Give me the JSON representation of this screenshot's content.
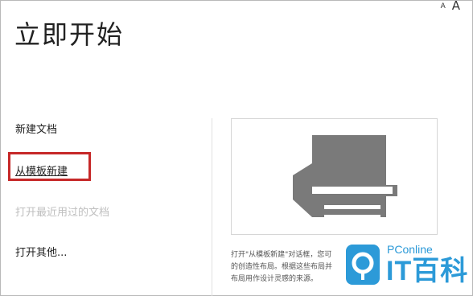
{
  "header": {
    "title": "立即开始",
    "font_small_label": "A",
    "font_large_label": "A"
  },
  "menu": {
    "new_document": "新建文档",
    "from_template": "从模板新建",
    "recent": "打开最近用过的文档",
    "open_other": "打开其他..."
  },
  "preview": {
    "icon": "document-template-icon",
    "description": [
      "打开\"从模板新建\"对话框，您可",
      "的创造性布局。根据这些布局并",
      "布局用作设计灵感的来源。"
    ]
  },
  "watermark": {
    "brand": "PConline",
    "name": "IT百科"
  },
  "colors": {
    "highlight": "#c62828",
    "icon_gray": "#7a7a7a",
    "watermark": "#2c9ad8"
  }
}
